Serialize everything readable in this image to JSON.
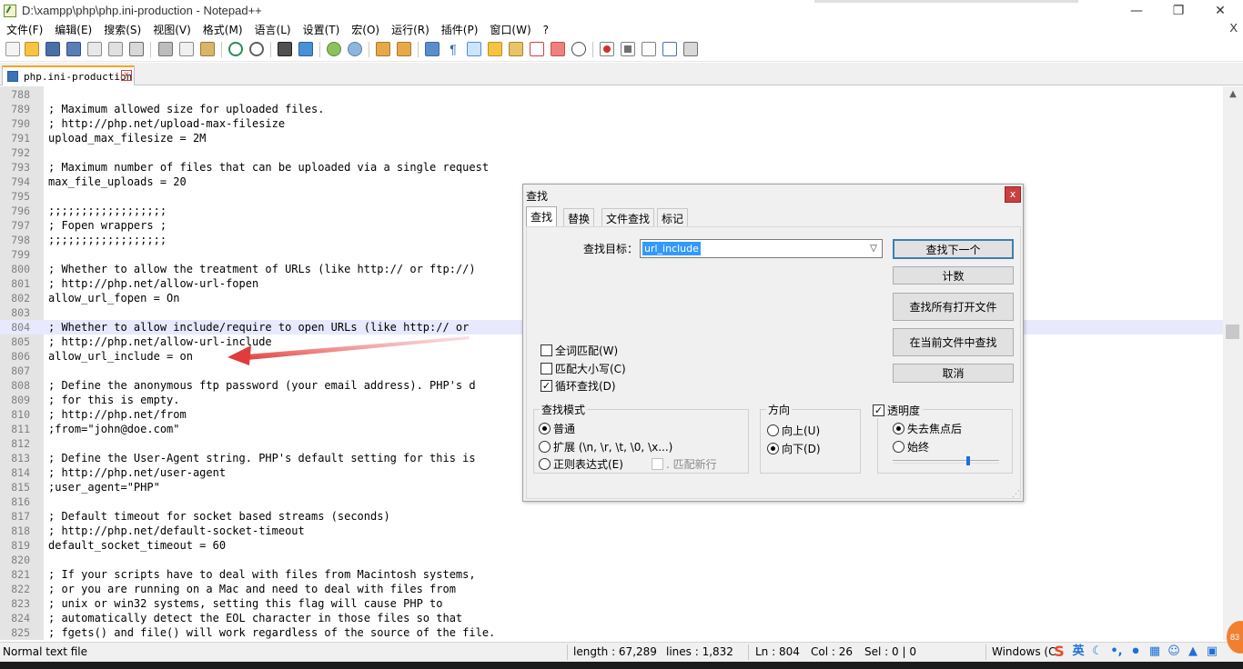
{
  "window": {
    "title": "D:\\xampp\\php\\php.ini-production - Notepad++"
  },
  "menubar": {
    "items": [
      "文件(F)",
      "编辑(E)",
      "搜索(S)",
      "视图(V)",
      "格式(M)",
      "语言(L)",
      "设置(T)",
      "宏(O)",
      "运行(R)",
      "插件(P)",
      "窗口(W)",
      "?"
    ],
    "close": "X"
  },
  "tab": {
    "label": "php.ini-production",
    "close": "x"
  },
  "editor": {
    "current_line": 804,
    "lines": [
      {
        "n": "788",
        "t": ""
      },
      {
        "n": "789",
        "t": "; Maximum allowed size for uploaded files."
      },
      {
        "n": "790",
        "t": "; http://php.net/upload-max-filesize"
      },
      {
        "n": "791",
        "t": "upload_max_filesize = 2M"
      },
      {
        "n": "792",
        "t": ""
      },
      {
        "n": "793",
        "t": "; Maximum number of files that can be uploaded via a single request"
      },
      {
        "n": "794",
        "t": "max_file_uploads = 20"
      },
      {
        "n": "795",
        "t": ""
      },
      {
        "n": "796",
        "t": ";;;;;;;;;;;;;;;;;;"
      },
      {
        "n": "797",
        "t": "; Fopen wrappers ;"
      },
      {
        "n": "798",
        "t": ";;;;;;;;;;;;;;;;;;"
      },
      {
        "n": "799",
        "t": ""
      },
      {
        "n": "800",
        "t": "; Whether to allow the treatment of URLs (like http:// or ftp://)"
      },
      {
        "n": "801",
        "t": "; http://php.net/allow-url-fopen"
      },
      {
        "n": "802",
        "t": "allow_url_fopen = On"
      },
      {
        "n": "803",
        "t": ""
      },
      {
        "n": "804",
        "t": "; Whether to allow include/require to open URLs (like http:// or"
      },
      {
        "n": "805",
        "t": "; http://php.net/allow-url-include"
      },
      {
        "n": "806",
        "t": "allow_url_include = on"
      },
      {
        "n": "807",
        "t": ""
      },
      {
        "n": "808",
        "t": "; Define the anonymous ftp password (your email address). PHP's d"
      },
      {
        "n": "809",
        "t": "; for this is empty."
      },
      {
        "n": "810",
        "t": "; http://php.net/from"
      },
      {
        "n": "811",
        "t": ";from=\"john@doe.com\""
      },
      {
        "n": "812",
        "t": ""
      },
      {
        "n": "813",
        "t": "; Define the User-Agent string. PHP's default setting for this is"
      },
      {
        "n": "814",
        "t": "; http://php.net/user-agent"
      },
      {
        "n": "815",
        "t": ";user_agent=\"PHP\""
      },
      {
        "n": "816",
        "t": ""
      },
      {
        "n": "817",
        "t": "; Default timeout for socket based streams (seconds)"
      },
      {
        "n": "818",
        "t": "; http://php.net/default-socket-timeout"
      },
      {
        "n": "819",
        "t": "default_socket_timeout = 60"
      },
      {
        "n": "820",
        "t": ""
      },
      {
        "n": "821",
        "t": "; If your scripts have to deal with files from Macintosh systems,"
      },
      {
        "n": "822",
        "t": "; or you are running on a Mac and need to deal with files from"
      },
      {
        "n": "823",
        "t": "; unix or win32 systems, setting this flag will cause PHP to"
      },
      {
        "n": "824",
        "t": "; automatically detect the EOL character in those files so that"
      },
      {
        "n": "825",
        "t": "; fgets() and file() will work regardless of the source of the file."
      }
    ]
  },
  "statusbar": {
    "filetype": "Normal text file",
    "length": "length : 67,289",
    "lines": "lines : 1,832",
    "ln": "Ln : 804",
    "col": "Col : 26",
    "sel": "Sel : 0 | 0",
    "eol": "Windows (C"
  },
  "tray": {
    "ime": "英",
    "badge": "83"
  },
  "find_dialog": {
    "title": "查找",
    "close": "x",
    "tabs": [
      "查找",
      "替换",
      "文件查找",
      "标记"
    ],
    "active_tab": "查找",
    "target_label": "查找目标：",
    "target_value": "url_include",
    "buttons": {
      "find_next": "查找下一个",
      "count": "计数",
      "find_all_open": "查找所有打开文件",
      "find_in_current": "在当前文件中查找",
      "cancel": "取消"
    },
    "options": {
      "whole_word": {
        "label": "全词匹配(W)",
        "checked": false
      },
      "match_case": {
        "label": "匹配大小写(C)",
        "checked": false
      },
      "wrap": {
        "label": "循环查找(D)",
        "checked": true
      }
    },
    "search_mode": {
      "title": "查找模式",
      "normal": "普通",
      "extended": "扩展 (\\n, \\r, \\t, \\0, \\x...)",
      "regex": "正则表达式(E)",
      "dot_newline": ". 匹配新行",
      "selected": "普通"
    },
    "direction": {
      "title": "方向",
      "up": "向上(U)",
      "down": "向下(D)",
      "selected": "向下(D)"
    },
    "transparency": {
      "title": "透明度",
      "checked": true,
      "on_lose_focus": "失去焦点后",
      "always": "始终",
      "selected": "失去焦点后",
      "level": 0.72
    }
  },
  "colors": {
    "current_line": "#e8e8ff",
    "annotation_arrow": "#e03c3c",
    "tab_accent": "#f5a623"
  }
}
